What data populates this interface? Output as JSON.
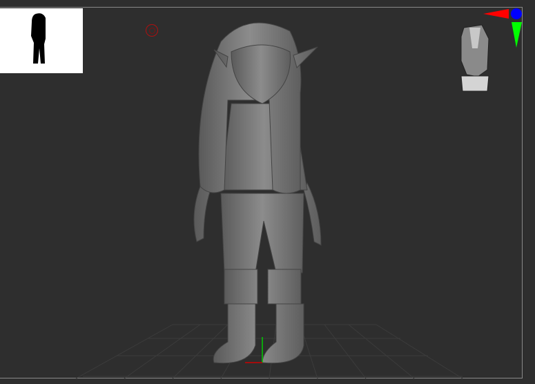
{
  "viewport": {
    "background": "#2e2e2e",
    "model_color": "#7a7a7a",
    "axis_colors": {
      "x": "#ff0000",
      "y": "#00ff00",
      "z": "#0000ff"
    }
  }
}
